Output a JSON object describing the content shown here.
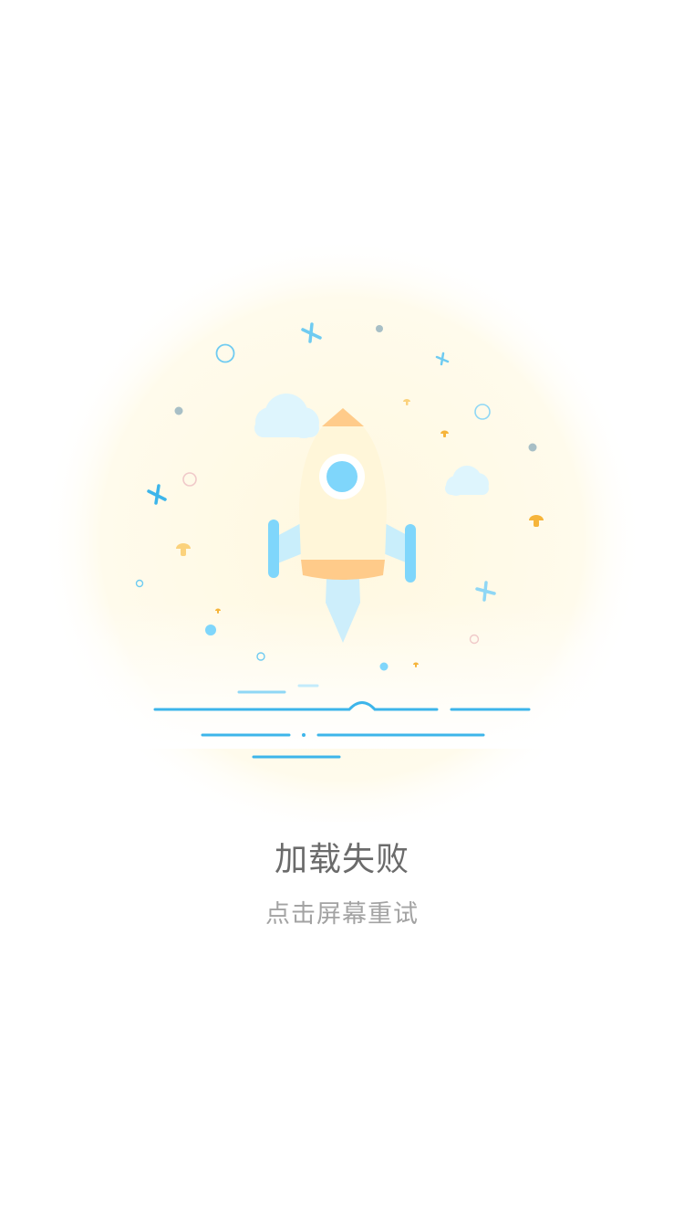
{
  "error": {
    "title": "加载失败",
    "hint": "点击屏幕重试"
  },
  "illustration": {
    "subject": "rocket-launch",
    "colors": {
      "background_glow": "#fffbea",
      "rocket_body": "#fff6d9",
      "rocket_accent": "#ffcb8a",
      "window": "#7fd6fb",
      "wing": "#7fd6fb",
      "flame": "#cdeefb",
      "cloud": "#def5fd",
      "ground_line": "#3db5ea",
      "dot_gray": "#a8bfc6",
      "mushroom": "#f6b43a"
    }
  }
}
